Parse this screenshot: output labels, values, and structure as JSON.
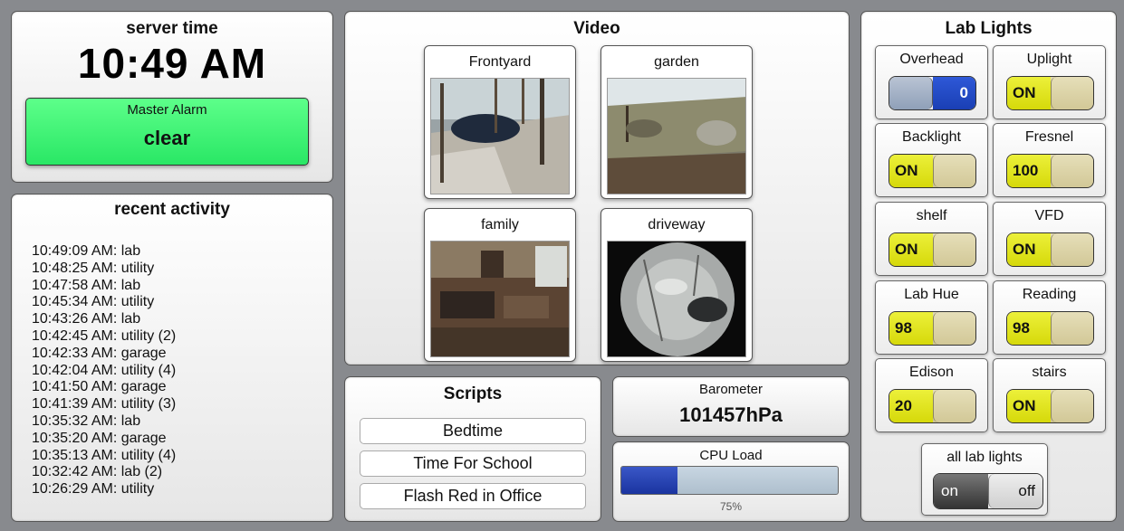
{
  "server_time": {
    "title": "server time",
    "time": "10:49 AM",
    "alarm_label": "Master Alarm",
    "alarm_value": "clear",
    "alarm_color": "#3bf070"
  },
  "recent_activity": {
    "title": "recent activity",
    "items": [
      "10:49:09 AM: lab",
      "10:48:25 AM: utility",
      "10:47:58 AM: lab",
      "10:45:34 AM: utility",
      "10:43:26 AM: lab",
      "10:42:45 AM: utility (2)",
      "10:42:33 AM: garage",
      "10:42:04 AM: utility (4)",
      "10:41:50 AM: garage",
      "10:41:39 AM: utility (3)",
      "10:35:32 AM: lab",
      "10:35:20 AM: garage",
      "10:35:13 AM: utility (4)",
      "10:32:42 AM: lab (2)",
      "10:26:29 AM: utility"
    ]
  },
  "video": {
    "title": "Video",
    "cameras": [
      {
        "name": "Frontyard"
      },
      {
        "name": "garden"
      },
      {
        "name": "family"
      },
      {
        "name": "driveway"
      }
    ]
  },
  "scripts": {
    "title": "Scripts",
    "buttons": [
      "Bedtime",
      "Time For School",
      "Flash Red in Office"
    ]
  },
  "barometer": {
    "label": "Barometer",
    "value": "101457hPa"
  },
  "cpu": {
    "label": "CPU Load",
    "percent_text": "75%",
    "fill_fraction": 0.26,
    "fill_color": "#2743b8"
  },
  "lab_lights": {
    "title": "Lab Lights",
    "lights": [
      {
        "name": "Overhead",
        "value": "0",
        "style": "blue"
      },
      {
        "name": "Uplight",
        "value": "ON",
        "style": "yellow"
      },
      {
        "name": "Backlight",
        "value": "ON",
        "style": "yellow"
      },
      {
        "name": "Fresnel",
        "value": "100",
        "style": "yellow"
      },
      {
        "name": "shelf",
        "value": "ON",
        "style": "yellow"
      },
      {
        "name": "VFD",
        "value": "ON",
        "style": "yellow"
      },
      {
        "name": "Lab Hue",
        "value": "98",
        "style": "yellow"
      },
      {
        "name": "Reading",
        "value": "98",
        "style": "yellow"
      },
      {
        "name": "Edison",
        "value": "20",
        "style": "yellow"
      },
      {
        "name": "stairs",
        "value": "ON",
        "style": "yellow"
      }
    ],
    "all": {
      "name": "all lab lights",
      "on_label": "on",
      "off_label": "off"
    }
  }
}
